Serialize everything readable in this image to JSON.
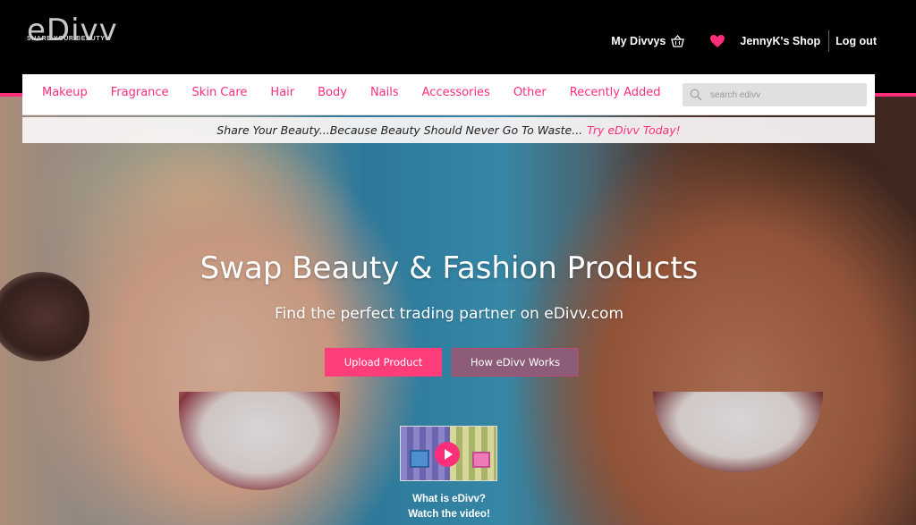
{
  "header": {
    "logo_text": "eDivv",
    "tagline": "SHARE YOUR BEAUTY",
    "my_divvys": "My Divvys",
    "shop_name": "JennyK's Shop",
    "logout": "Log out"
  },
  "nav": {
    "categories": [
      "Makeup",
      "Fragrance",
      "Skin Care",
      "Hair",
      "Body",
      "Nails",
      "Accessories",
      "Other",
      "Recently Added"
    ],
    "search_placeholder": "search edivv"
  },
  "strip": {
    "message": "Share Your Beauty...Because Beauty Should Never Go To Waste...",
    "cta": "Try eDivv Today!"
  },
  "hero": {
    "headline": "Swap Beauty & Fashion Products",
    "subheadline": "Find the perfect trading partner on eDivv.com",
    "upload_button": "Upload Product",
    "how_button": "How eDivv Works",
    "video_caption_line1": "What is eDivv?",
    "video_caption_line2": "Watch the video!"
  },
  "colors": {
    "accent": "#ff2e79",
    "secondary_button": "#8d5c79",
    "header_bg": "#000000"
  },
  "icons": [
    "basket-icon",
    "heart-icon",
    "search-icon",
    "play-icon"
  ]
}
